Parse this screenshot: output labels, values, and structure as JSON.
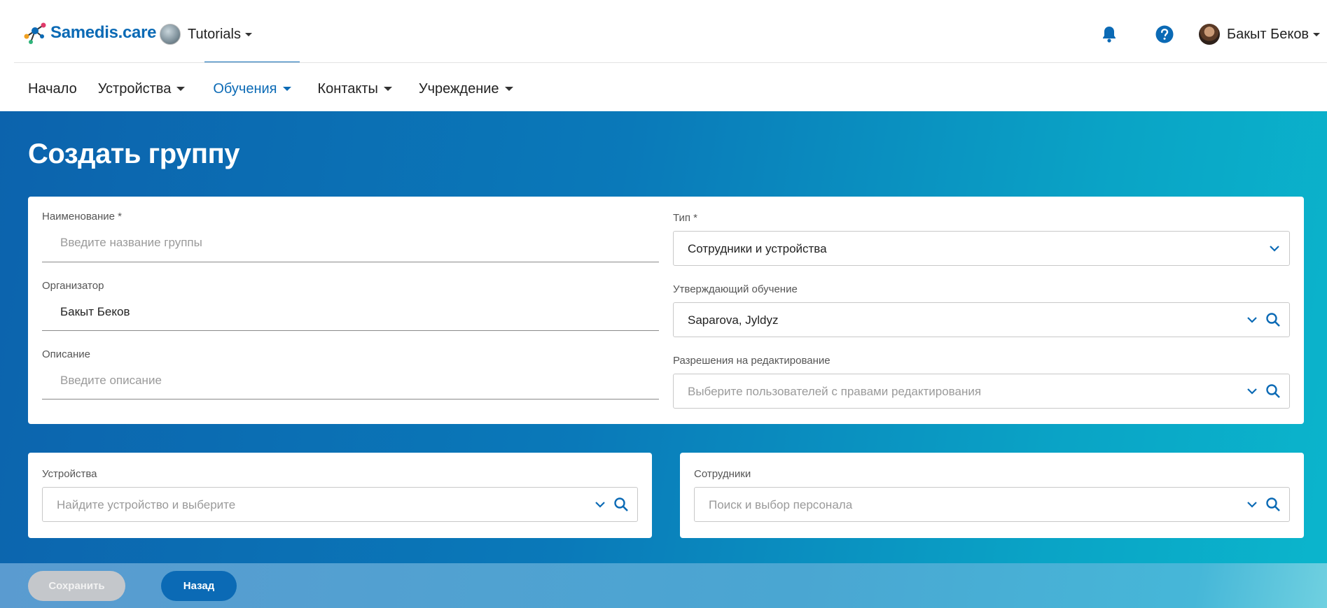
{
  "header": {
    "logo_text": "Samedis.care",
    "org_name": "Tutorials",
    "user_name": "Бакыт Беков",
    "icons": [
      "bell-icon",
      "help-icon"
    ]
  },
  "nav": {
    "items": [
      {
        "label": "Начало"
      },
      {
        "label": "Устройства"
      },
      {
        "label": "Обучения"
      },
      {
        "label": "Контакты"
      },
      {
        "label": "Учреждение"
      }
    ],
    "active": "Обучения"
  },
  "page": {
    "title": "Создать группу"
  },
  "form": {
    "name": {
      "label": "Наименование *",
      "placeholder": "Введите название группы"
    },
    "organizer": {
      "label": "Организатор",
      "value": "Бакыт Беков"
    },
    "description": {
      "label": "Описание",
      "placeholder": "Введите описание"
    },
    "type": {
      "label": "Тип *",
      "value": "Сотрудники и устройства"
    },
    "approver": {
      "label": "Утверждающий обучение",
      "value": "Saparova, Jyldyz"
    },
    "edit_permissions": {
      "label": "Разрешения на редактирование",
      "placeholder": "Выберите пользователей с правами редактирования"
    }
  },
  "devices": {
    "label": "Устройства",
    "placeholder": "Найдите устройство и выберите"
  },
  "employees": {
    "label": "Сотрудники",
    "placeholder": "Поиск и выбор персонала"
  },
  "footer": {
    "save_label": "Сохранить",
    "back_label": "Назад"
  },
  "colors": {
    "brand": "#0b6ab5",
    "save_disabled": "#c4c7cb"
  }
}
